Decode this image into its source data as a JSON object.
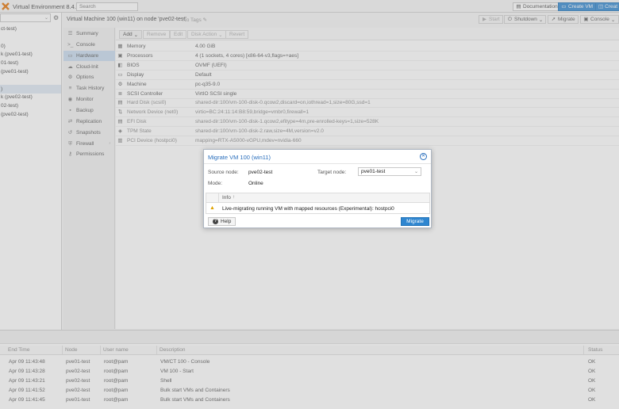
{
  "topbar": {
    "product": "Virtual Environment 8.4.0",
    "search_placeholder": "Search",
    "documentation": "Documentation",
    "create_vm": "Create VM",
    "create_ct": "Creat"
  },
  "tree": {
    "items": [
      "ct-test)",
      "",
      "0)",
      "k (pve01-test)",
      "01-test)",
      "(pve01-test)",
      "",
      ")",
      "k (pve02-test)",
      "02-test)",
      "(pve02-test)"
    ],
    "selected_index": 7
  },
  "header": {
    "vm_title": "Virtual Machine 100 (win11) on node 'pve02-test'",
    "tags": "No Tags",
    "start": "Start",
    "shutdown": "Shutdown",
    "migrate": "Migrate",
    "console": "Console"
  },
  "vmnav": {
    "items": [
      {
        "label": "Summary",
        "icon": "summary-icon"
      },
      {
        "label": "Console",
        "icon": "console-icon"
      },
      {
        "label": "Hardware",
        "icon": "hardware-icon",
        "selected": true
      },
      {
        "label": "Cloud-Init",
        "icon": "cloud-icon"
      },
      {
        "label": "Options",
        "icon": "gear-icon"
      },
      {
        "label": "Task History",
        "icon": "list-icon"
      },
      {
        "label": "Monitor",
        "icon": "eye-icon"
      },
      {
        "label": "Backup",
        "icon": "floppy-icon"
      },
      {
        "label": "Replication",
        "icon": "retweet-icon"
      },
      {
        "label": "Snapshots",
        "icon": "history-icon"
      },
      {
        "label": "Firewall",
        "icon": "shield-icon",
        "has_chevron": true
      },
      {
        "label": "Permissions",
        "icon": "unlock-icon"
      }
    ]
  },
  "hardware": {
    "toolbar": {
      "add": "Add",
      "remove": "Remove",
      "edit": "Edit",
      "disk_action": "Disk Action",
      "revert": "Revert"
    },
    "rows": [
      {
        "label": "Memory",
        "value": "4.00 GiB",
        "icon": "memory-icon"
      },
      {
        "label": "Processors",
        "value": "4 (1 sockets, 4 cores) [x86-64-v3,flags=+aes]",
        "icon": "cpu-icon"
      },
      {
        "label": "BIOS",
        "value": "OVMF (UEFI)",
        "icon": "bios-icon"
      },
      {
        "label": "Display",
        "value": "Default",
        "icon": "display-icon"
      },
      {
        "label": "Machine",
        "value": "pc-q35-9.0",
        "icon": "machine-icon"
      },
      {
        "label": "SCSI Controller",
        "value": "VirtIO SCSI single",
        "icon": "database-icon"
      },
      {
        "label": "Hard Disk (scsi0)",
        "value": "shared-dir:100/vm-100-disk-0.qcow2,discard=on,iothread=1,size=80G,ssd=1",
        "icon": "hdd-icon"
      },
      {
        "label": "Network Device (net0)",
        "value": "virtio=BC:24:11:14:B8:59,bridge=vmbr0,firewall=1",
        "icon": "network-icon"
      },
      {
        "label": "EFI Disk",
        "value": "shared-dir:100/vm-100-disk-1.qcow2,efitype=4m,pre-enrolled-keys=1,size=528K",
        "icon": "hdd-icon"
      },
      {
        "label": "TPM State",
        "value": "shared-dir:100/vm-100-disk-2.raw,size=4M,version=v2.0",
        "icon": "tpm-icon"
      },
      {
        "label": "PCI Device (hostpci0)",
        "value": "mapping=RTX-A5000-vGPU,mdev=nvidia-660",
        "icon": "pci-icon"
      }
    ]
  },
  "tasklog": {
    "columns": [
      "End Time",
      "Node",
      "User name",
      "Description",
      "Status"
    ],
    "rows": [
      {
        "end": "Apr 09 11:43:48",
        "node": "pve01-test",
        "user": "root@pam",
        "desc": "VM/CT 100 - Console",
        "status": "OK"
      },
      {
        "end": "Apr 09 11:43:28",
        "node": "pve02-test",
        "user": "root@pam",
        "desc": "VM 100 - Start",
        "status": "OK"
      },
      {
        "end": "Apr 09 11:43:21",
        "node": "pve02-test",
        "user": "root@pam",
        "desc": "Shell",
        "status": "OK"
      },
      {
        "end": "Apr 09 11:41:52",
        "node": "pve02-test",
        "user": "root@pam",
        "desc": "Bulk start VMs and Containers",
        "status": "OK"
      },
      {
        "end": "Apr 09 11:41:45",
        "node": "pve01-test",
        "user": "root@pam",
        "desc": "Bulk start VMs and Containers",
        "status": "OK"
      }
    ]
  },
  "dialog": {
    "title": "Migrate VM 100 (win11)",
    "source_label": "Source node:",
    "source_value": "pve02-test",
    "target_label": "Target node:",
    "target_value": "pve01-test",
    "mode_label": "Mode:",
    "mode_value": "Online",
    "info_header": "Info",
    "info_sort_arrow": "↑",
    "warning": "Live-migrating running VM with mapped resources (Experimental): hostpci0",
    "help": "Help",
    "migrate": "Migrate"
  },
  "colors": {
    "accent": "#2f86d0",
    "title_blue": "#2a6fbd",
    "warning": "#e0a300",
    "logo_orange": "#e57000"
  }
}
